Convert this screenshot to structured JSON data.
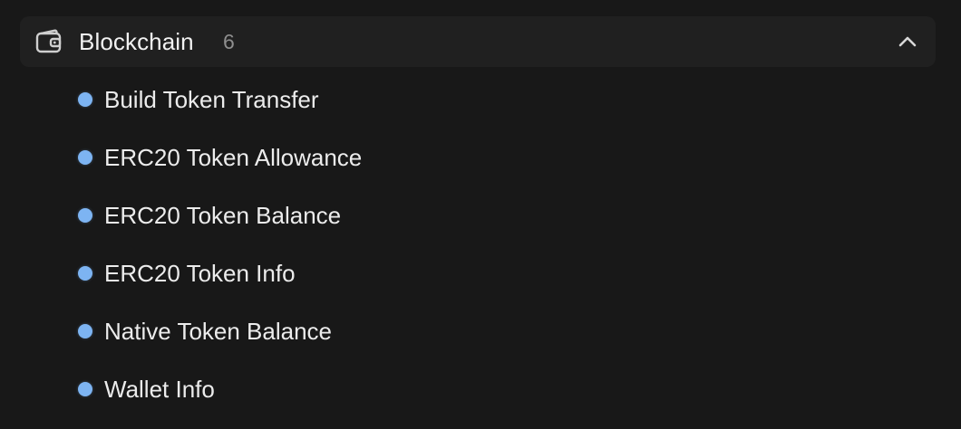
{
  "group": {
    "title": "Blockchain",
    "count": "6",
    "icon": "wallet-icon",
    "toggle_icon": "chevron-up-icon",
    "expanded": true
  },
  "items": [
    {
      "label": "Build Token Transfer"
    },
    {
      "label": "ERC20 Token Allowance"
    },
    {
      "label": "ERC20 Token Balance"
    },
    {
      "label": "ERC20 Token Info"
    },
    {
      "label": "Native Token Balance"
    },
    {
      "label": "Wallet Info"
    }
  ],
  "colors": {
    "background": "#181818",
    "header_background": "#202020",
    "bullet": "#7db4f2",
    "text": "#ececec",
    "count_text": "#8e8e8e"
  }
}
